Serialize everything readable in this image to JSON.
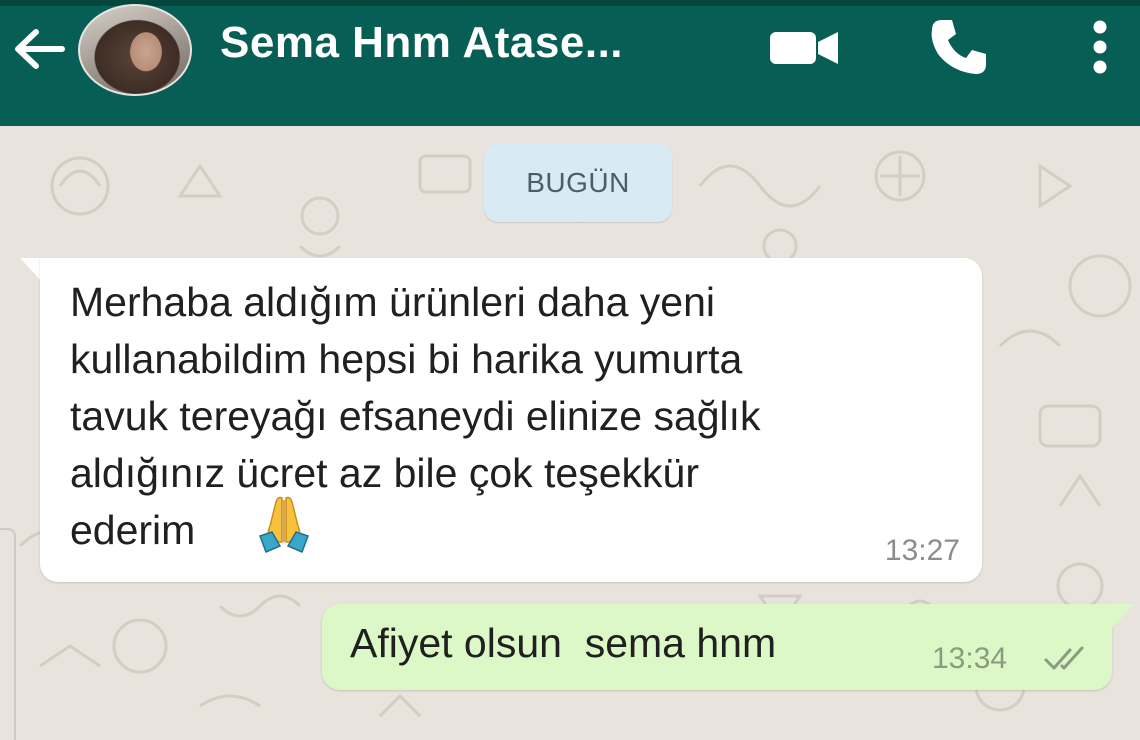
{
  "header": {
    "back_icon": "arrow-left-icon",
    "contact_name": "Sema Hnm Atase...",
    "video_icon": "videocam-icon",
    "call_icon": "phone-icon",
    "menu_icon": "more-vert-icon",
    "background": "#075e54"
  },
  "chat": {
    "date_chip": "BUGÜN",
    "messages": [
      {
        "direction": "incoming",
        "text": "Merhaba aldığım ürünleri daha yeni\nkullanabildim hepsi bi harika yumurta\ntavuk tereyağı efsaneydi elinize sağlık\naldığınız ücret az bile çok teşekkür\nederim",
        "emoji": "folded-hands-emoji",
        "time": "13:27",
        "bubble_color": "#ffffff"
      },
      {
        "direction": "outgoing",
        "text": "Afiyet olsun  sema hnm",
        "time": "13:34",
        "status": "double-check-icon",
        "bubble_color": "#dcf8c6"
      }
    ]
  }
}
